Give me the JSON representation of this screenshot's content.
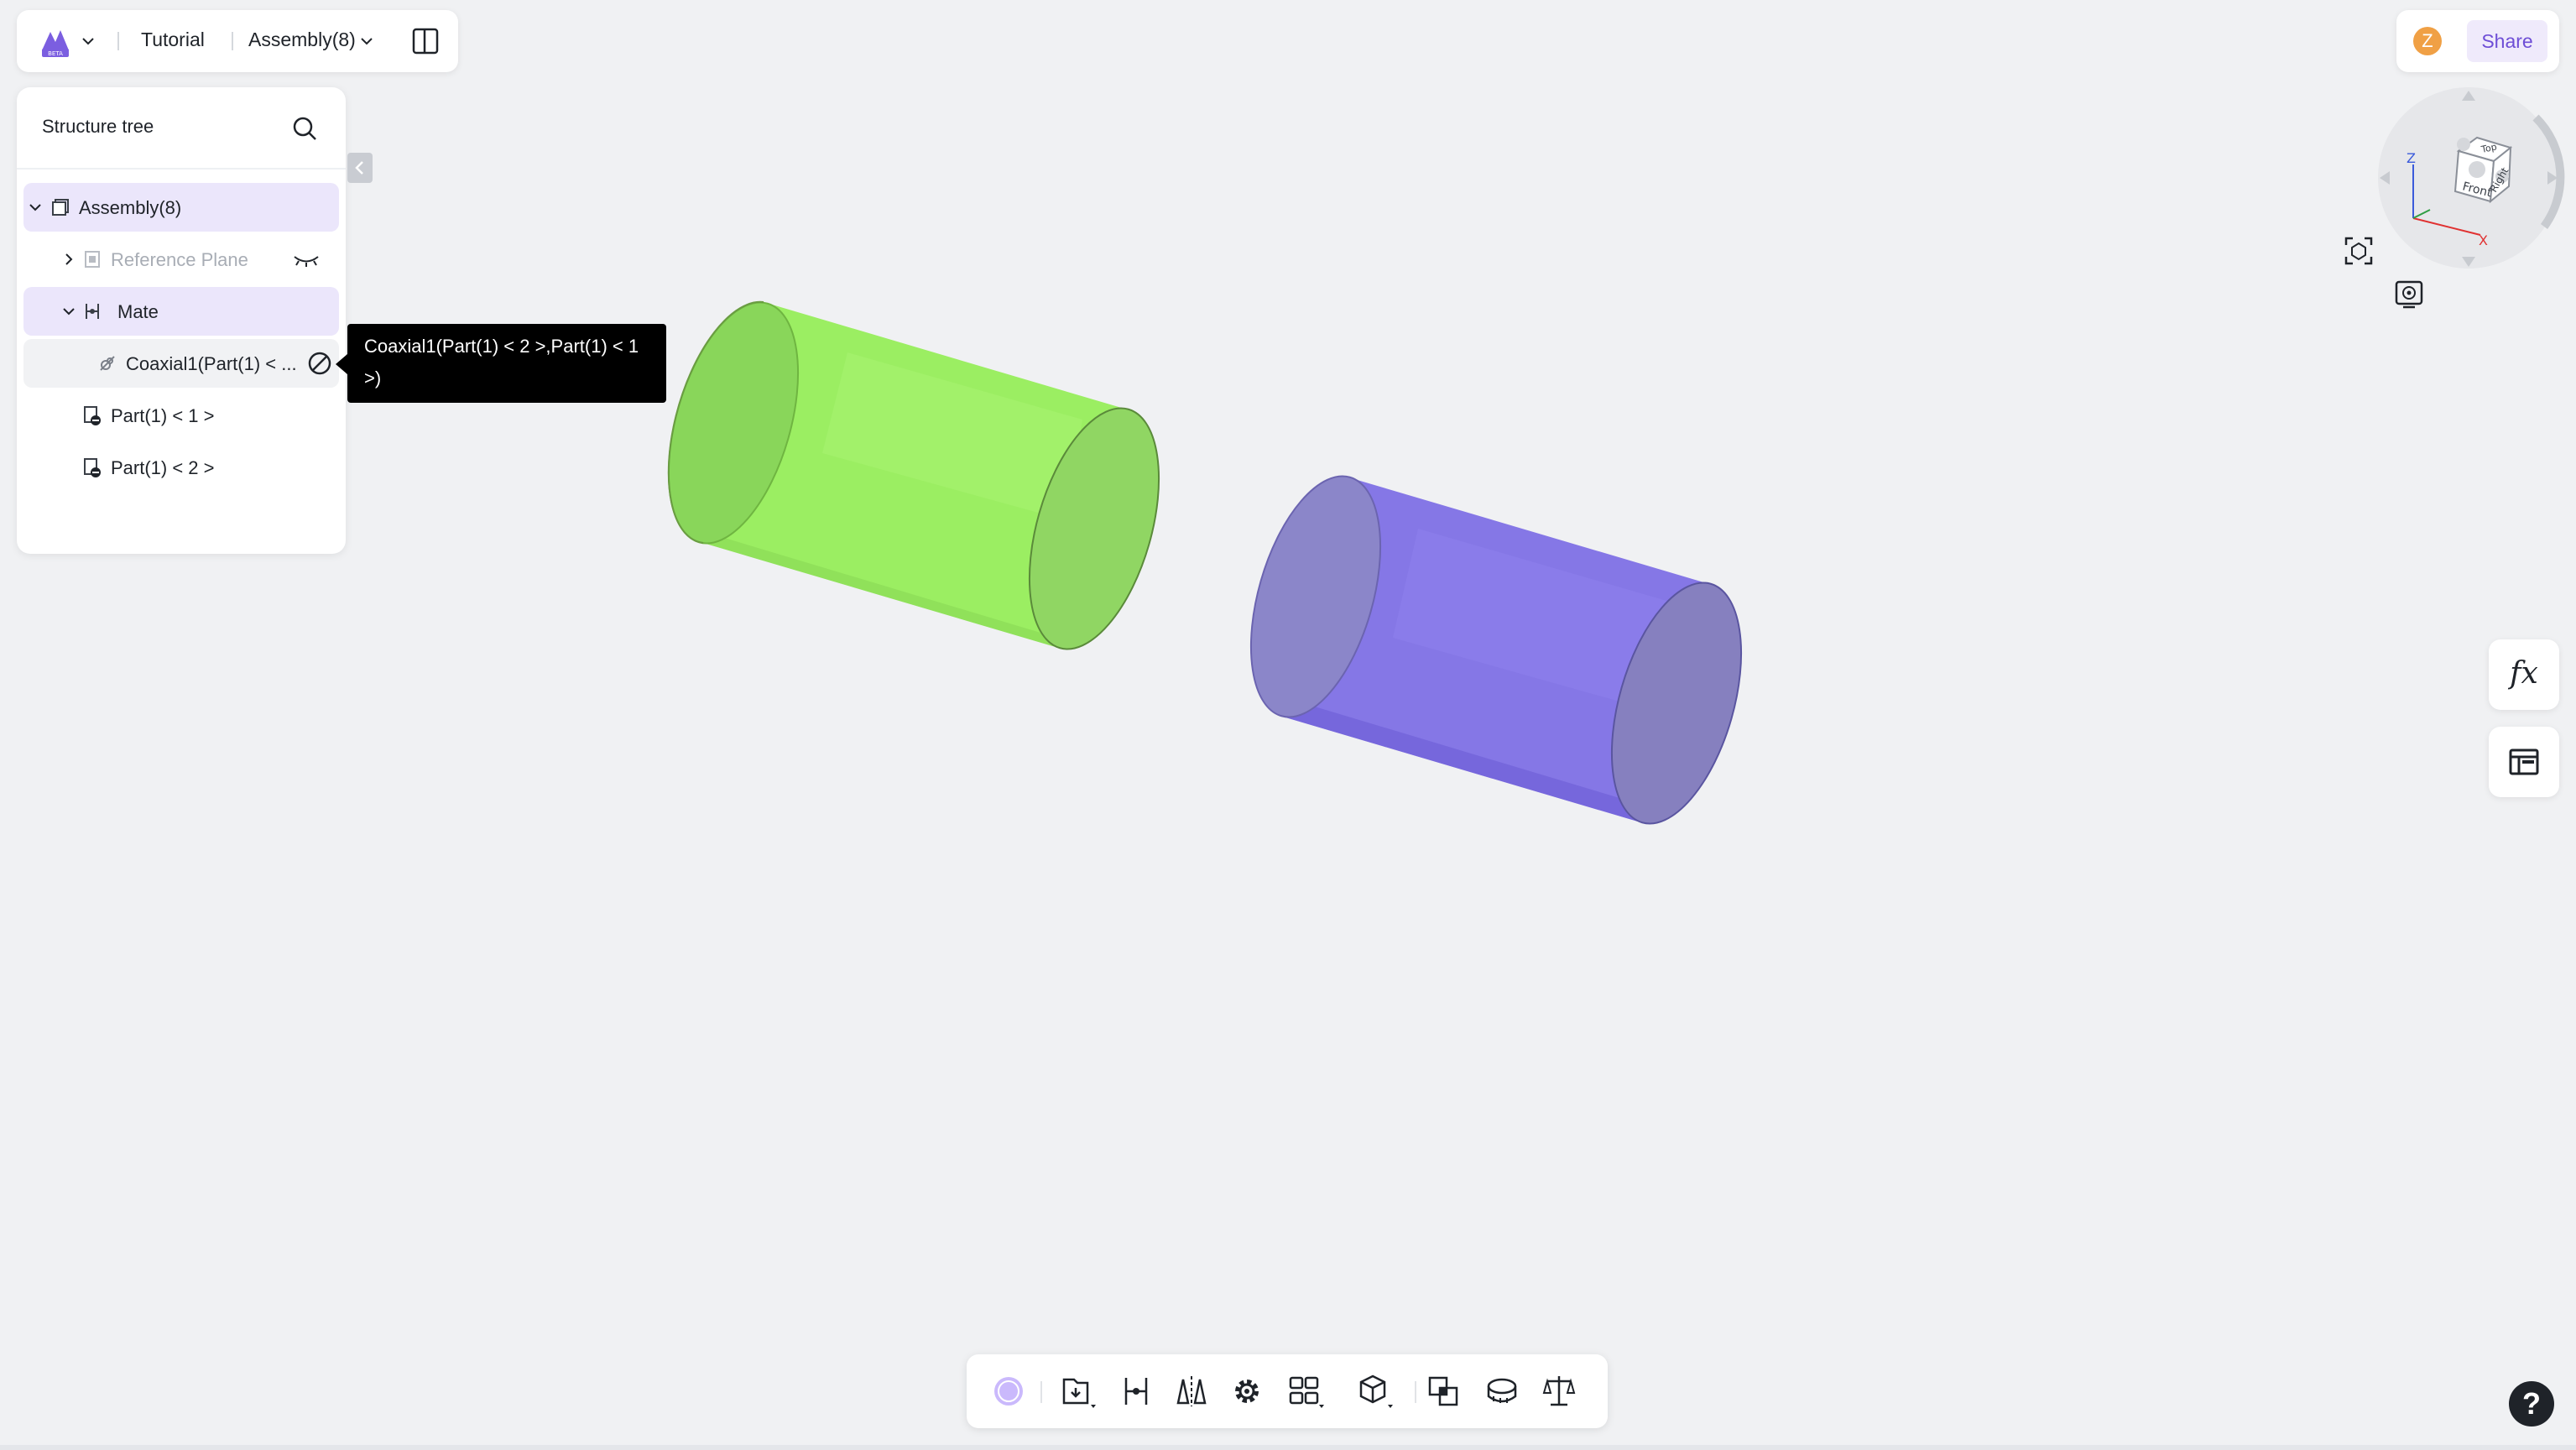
{
  "topbar": {
    "app_logo_icon": "app-logo-beta-icon",
    "logo_badge": "BETA",
    "project_name": "Tutorial",
    "document_name": "Assembly(8)"
  },
  "user": {
    "avatar_initial": "Z",
    "share_label": "Share",
    "avatar_color": "#f0a045"
  },
  "tree": {
    "title": "Structure tree",
    "items": [
      {
        "label": "Assembly(8)",
        "expanded": true,
        "selected": true
      },
      {
        "label": "Reference Plane",
        "expanded": false,
        "hidden": true
      },
      {
        "label": "Mate",
        "expanded": true,
        "selected": true
      },
      {
        "label": "Coaxial1(Part(1) < ...",
        "suppressed": true
      },
      {
        "label": "Part(1) < 1 >"
      },
      {
        "label": "Part(1) < 2 >"
      }
    ]
  },
  "tooltip": {
    "text": "Coaxial1(Part(1) < 2 >,Part(1) < 1 >)"
  },
  "navcube": {
    "faces": [
      "Top",
      "Front",
      "Right"
    ],
    "axes": [
      "Z",
      "X"
    ]
  },
  "viewport": {
    "parts": [
      {
        "name": "Part(1) < 1 >",
        "color": "#9bee62"
      },
      {
        "name": "Part(1) < 2 >",
        "color": "#8577e6"
      }
    ]
  },
  "side_buttons": {
    "formula_label": "fx",
    "table_icon": "table-icon"
  },
  "toolbar": {
    "icons": [
      "sketch-circle-icon",
      "insert-part-icon",
      "mate-icon",
      "mirror-icon",
      "gear-icon",
      "pattern-icon",
      "explode-view-icon",
      "interference-check-icon",
      "measure-icon",
      "mass-properties-icon"
    ]
  },
  "help_label": "?",
  "colors": {
    "accent": "#6e4ed6",
    "selected_row": "#ebe6fb",
    "background": "#f0f1f3"
  }
}
